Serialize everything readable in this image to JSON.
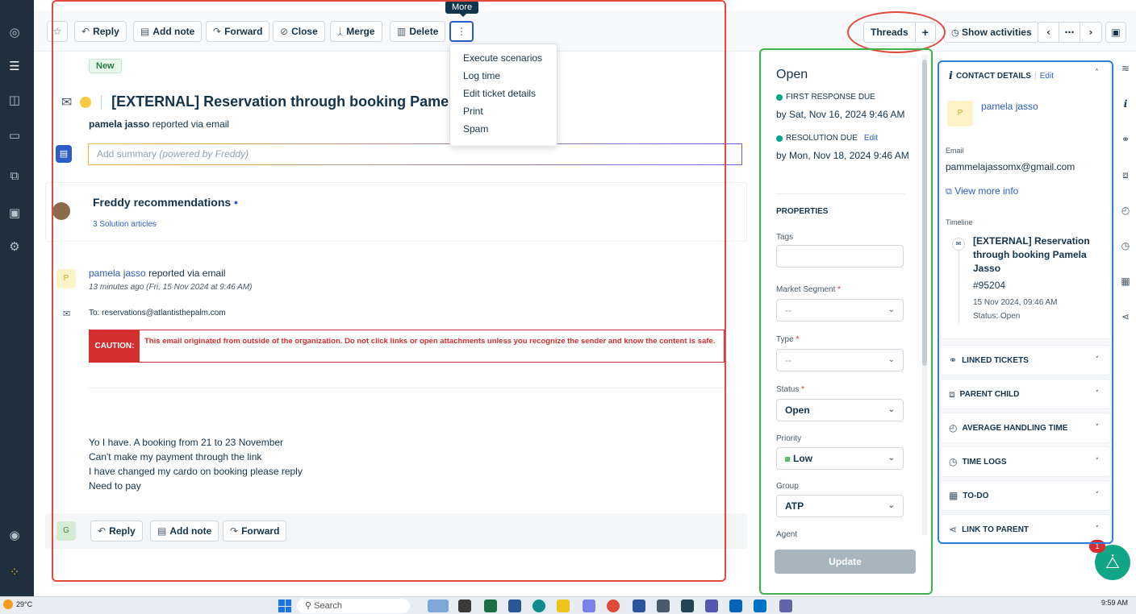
{
  "toolbar": {
    "buttons": [
      {
        "label": "Reply",
        "icon": "reply-icon"
      },
      {
        "label": "Add note",
        "icon": "note-icon"
      },
      {
        "label": "Forward",
        "icon": "forward-icon"
      },
      {
        "label": "Close",
        "icon": "check-circle-icon"
      },
      {
        "label": "Merge",
        "icon": "merge-icon"
      },
      {
        "label": "Delete",
        "icon": "trash-icon"
      }
    ],
    "more_tooltip": "More",
    "more_menu": [
      "Execute scenarios",
      "Log time",
      "Edit ticket details",
      "Print",
      "Spam"
    ],
    "threads_label": "Threads",
    "show_activities_label": "Show activities"
  },
  "ticket": {
    "badge": "New",
    "subject": "[EXTERNAL] Reservation through booking Pamela Ja",
    "reporter": "pamela jasso",
    "reported_via": "reported via email",
    "summary_placeholder": "Add summary",
    "summary_hint": "(powered by Freddy)"
  },
  "freddy": {
    "title": "Freddy recommendations",
    "subtitle": "3 Solution articles"
  },
  "message": {
    "avatar_letter": "P",
    "from": "pamela jasso",
    "via": "reported via email",
    "time": "13 minutes ago (Fri, 15 Nov 2024 at 9:46 AM)",
    "to": "To: reservations@atlantisthepalm.com",
    "caution_label": "CAUTION:",
    "caution_text": "This email originated from outside of the organization. Do not click links or open attachments unless you recognize the sender and know the content is safe.",
    "body_lines": [
      "Yo I have. A booking from 21 to 23 November",
      "Can't make my payment through the link",
      "I have changed my cardo on booking please reply",
      "Need to pay"
    ]
  },
  "reply_bar": {
    "avatar_letter": "G",
    "reply": "Reply",
    "add_note": "Add note",
    "forward": "Forward"
  },
  "properties": {
    "status_title": "Open",
    "first_response_label": "FIRST RESPONSE DUE",
    "first_response_value": "by Sat, Nov 16, 2024 9:46 AM",
    "resolution_label": "RESOLUTION DUE",
    "resolution_edit": "Edit",
    "resolution_value": "by Mon, Nov 18, 2024 9:46 AM",
    "heading": "PROPERTIES",
    "tags_label": "Tags",
    "market_segment_label": "Market Segment",
    "market_segment_value": "--",
    "type_label": "Type",
    "type_value": "--",
    "status_label": "Status",
    "status_value": "Open",
    "priority_label": "Priority",
    "priority_value": "Low",
    "group_label": "Group",
    "group_value": "ATP",
    "agent_label": "Agent",
    "required_mark": "*",
    "update_button": "Update"
  },
  "contact": {
    "heading": "CONTACT DETAILS",
    "edit": "Edit",
    "avatar_letter": "P",
    "name": "pamela jasso",
    "email_label": "Email",
    "email": "pammelajassomx@gmail.com",
    "view_more": "View more info",
    "timeline_label": "Timeline",
    "timeline_title": "[EXTERNAL] Reservation through booking Pamela Jasso",
    "timeline_number": "#95204",
    "timeline_date": "15 Nov 2024, 09:46 AM",
    "timeline_status": "Status: Open",
    "sections": [
      {
        "label": "LINKED TICKETS",
        "icon": "link-icon"
      },
      {
        "label": "PARENT CHILD",
        "icon": "hierarchy-icon"
      },
      {
        "label": "AVERAGE HANDLING TIME",
        "icon": "timer-icon"
      },
      {
        "label": "TIME LOGS",
        "icon": "stopwatch-icon"
      },
      {
        "label": "TO-DO",
        "icon": "calendar-icon"
      },
      {
        "label": "LINK TO PARENT",
        "icon": "share-icon"
      }
    ]
  },
  "fab_badge": "1",
  "taskbar": {
    "temperature": "29°C",
    "search_placeholder": "Search",
    "time": "9:59 AM"
  },
  "colors": {
    "annotation_red": "#e24b3b",
    "annotation_green": "#3db34a",
    "annotation_blue": "#2f7fd6",
    "accent_blue": "#2c5cc5",
    "caution_red": "#d32f2f"
  }
}
